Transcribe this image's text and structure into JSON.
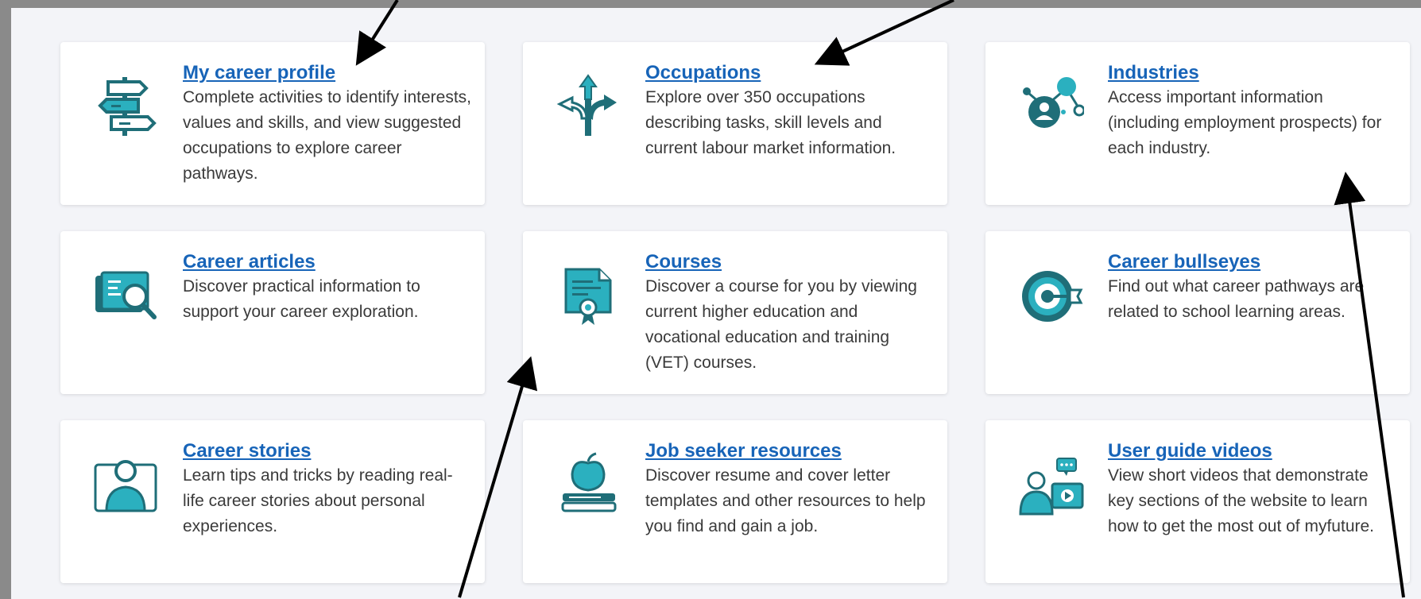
{
  "accent_color": "#1f8a96",
  "link_color": "#1764b8",
  "cards": [
    {
      "title": "My career profile",
      "description": "Complete activities to identify interests, values and skills, and view suggested occupations to explore career pathways.",
      "icon": "signpost-icon"
    },
    {
      "title": "Occupations",
      "description": "Explore over 350 occupations describing tasks, skill levels and current labour market information.",
      "icon": "crossroads-arrows-icon"
    },
    {
      "title": "Industries",
      "description": "Access important information (including employment prospects) for each industry.",
      "icon": "network-person-icon"
    },
    {
      "title": "Career articles",
      "description": "Discover practical information to support your career exploration.",
      "icon": "article-search-icon"
    },
    {
      "title": "Courses",
      "description": "Discover a course for you by viewing current higher education and vocational education and training (VET) courses.",
      "icon": "certificate-icon"
    },
    {
      "title": "Career bullseyes",
      "description": "Find out what career pathways are related to school learning areas.",
      "icon": "bullseye-target-icon"
    },
    {
      "title": "Career stories",
      "description": "Learn tips and tricks by reading real-life career stories about personal experiences.",
      "icon": "person-portrait-icon"
    },
    {
      "title": "Job seeker resources",
      "description": "Discover resume and cover letter templates and other resources to help you find and gain a job.",
      "icon": "apple-books-icon"
    },
    {
      "title": "User guide videos",
      "description": "View short videos that demonstrate key sections of the website to learn how to get the most out of myfuture.",
      "icon": "video-guide-icon"
    }
  ]
}
